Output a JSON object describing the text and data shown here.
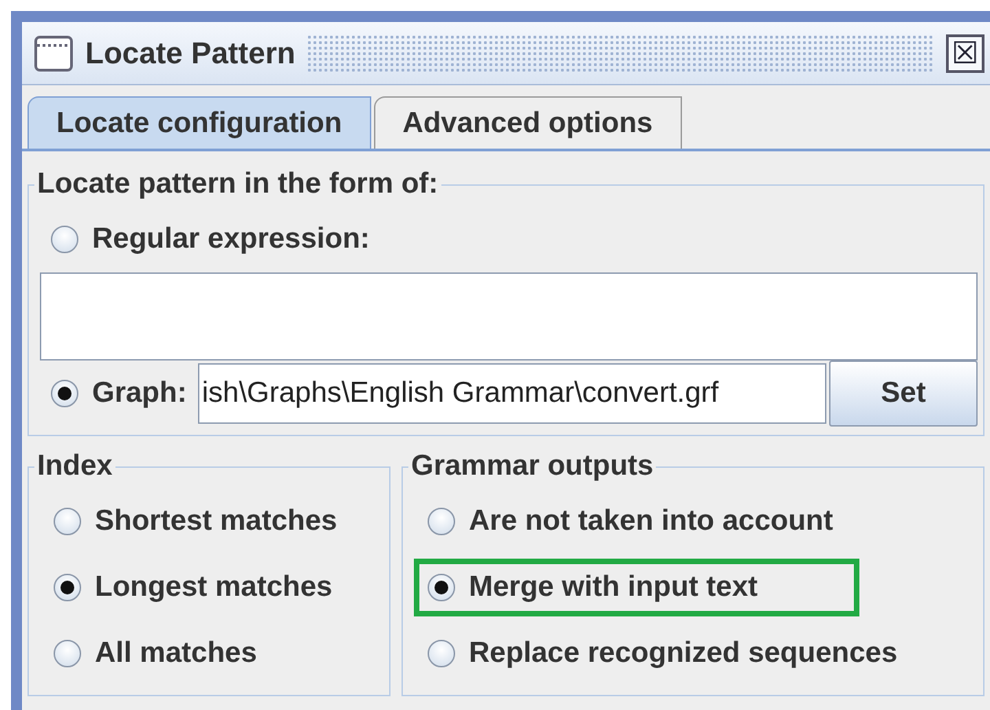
{
  "window": {
    "title": "Locate Pattern",
    "close": "☒"
  },
  "tabs": [
    {
      "label": "Locate configuration",
      "selected": true
    },
    {
      "label": "Advanced options",
      "selected": false
    }
  ],
  "pattern_group": {
    "title": "Locate pattern in the form of:",
    "regex": {
      "label": "Regular expression:",
      "selected": false
    },
    "graph": {
      "label": "Graph:",
      "selected": true,
      "value": "ish\\Graphs\\English Grammar\\convert.grf",
      "button": "Set"
    }
  },
  "index": {
    "title": "Index",
    "options": [
      {
        "label": "Shortest matches",
        "selected": false
      },
      {
        "label": "Longest matches",
        "selected": true
      },
      {
        "label": "All matches",
        "selected": false
      }
    ]
  },
  "grammar_outputs": {
    "title": "Grammar outputs",
    "options": [
      {
        "label": "Are not taken into account",
        "selected": false,
        "highlighted": false
      },
      {
        "label": "Merge with input text",
        "selected": true,
        "highlighted": true
      },
      {
        "label": "Replace recognized sequences",
        "selected": false,
        "highlighted": false
      }
    ]
  }
}
